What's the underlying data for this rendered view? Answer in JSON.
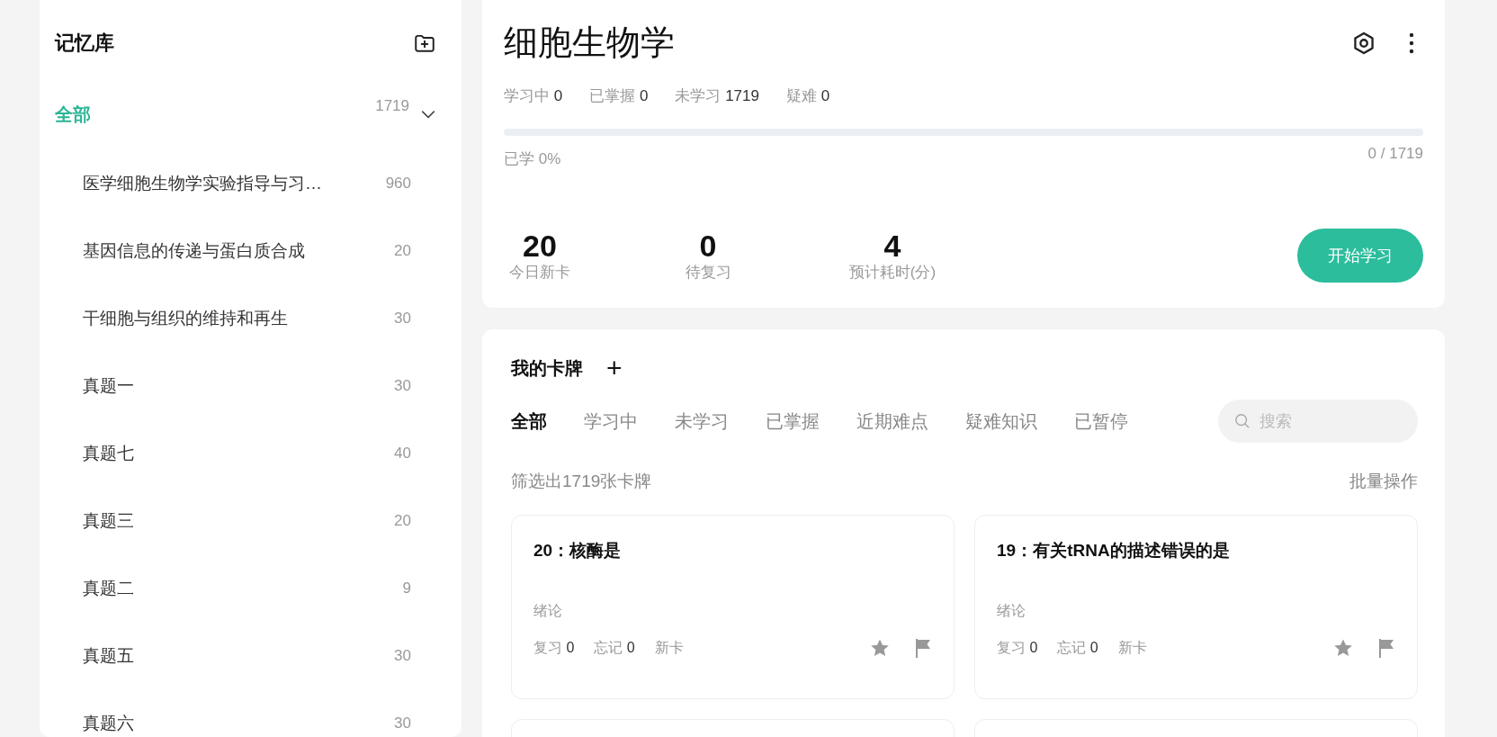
{
  "sidebar": {
    "title": "记忆库",
    "tree": {
      "label": "全部",
      "count": "1719",
      "selected": true,
      "expanded": true,
      "children": [
        {
          "label": "医学细胞生物学实验指导与习…",
          "count": "960",
          "selected": false
        },
        {
          "label": "基因信息的传递与蛋白质合成",
          "count": "20",
          "selected": false
        },
        {
          "label": "干细胞与组织的维持和再生",
          "count": "30",
          "selected": false
        },
        {
          "label": "真题一",
          "count": "30",
          "selected": false
        },
        {
          "label": "真题七",
          "count": "40",
          "selected": false
        },
        {
          "label": "真题三",
          "count": "20",
          "selected": false
        },
        {
          "label": "真题二",
          "count": "9",
          "selected": false
        },
        {
          "label": "真题五",
          "count": "30",
          "selected": false
        },
        {
          "label": "真题六",
          "count": "30",
          "selected": false
        }
      ]
    }
  },
  "overview": {
    "title": "细胞生物学",
    "stats": [
      {
        "label": "学习中",
        "value": "0"
      },
      {
        "label": "已掌握",
        "value": "0"
      },
      {
        "label": "未学习",
        "value": "1719"
      },
      {
        "label": "疑难",
        "value": "0"
      }
    ],
    "progress": {
      "level": 0,
      "label": "已学 0%",
      "reading": "0 / 1719"
    },
    "metrics": [
      {
        "value": "20",
        "label": "今日新卡"
      },
      {
        "value": "0",
        "label": "待复习"
      },
      {
        "value": "4",
        "label": "预计耗时(分)"
      }
    ],
    "start_button": "开始学习"
  },
  "cards_section": {
    "title": "我的卡牌",
    "add_symbol": "+",
    "tabs": [
      {
        "label": "全部",
        "selected": true
      },
      {
        "label": "学习中",
        "selected": false
      },
      {
        "label": "未学习",
        "selected": false
      },
      {
        "label": "已掌握",
        "selected": false
      },
      {
        "label": "近期难点",
        "selected": false
      },
      {
        "label": "疑难知识",
        "selected": false
      },
      {
        "label": "已暂停",
        "selected": false
      }
    ],
    "search": {
      "placeholder": "搜索"
    },
    "filter_summary": "筛选出1719张卡牌",
    "bulk_action": "批量操作",
    "cards": [
      {
        "title": "20：核酶是",
        "chapter": "绪论",
        "review_label": "复习",
        "review": "0",
        "forget_label": "忘记",
        "forget": "0",
        "status": "新卡"
      },
      {
        "title": "19：有关tRNA的描述错误的是",
        "chapter": "绪论",
        "review_label": "复习",
        "review": "0",
        "forget_label": "忘记",
        "forget": "0",
        "status": "新卡"
      }
    ]
  }
}
